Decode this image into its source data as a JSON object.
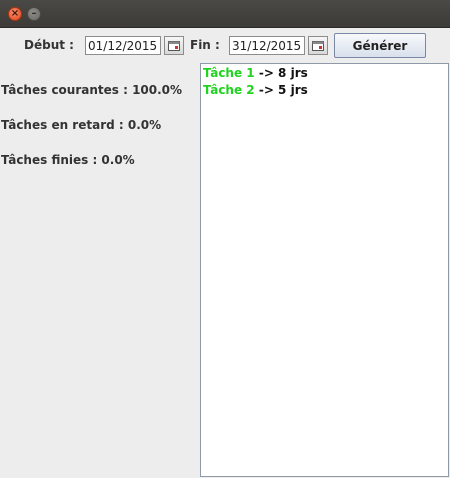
{
  "window": {
    "close_icon": "close-icon",
    "minimize_icon": "minimize-icon"
  },
  "form": {
    "debut_label": "Début :",
    "debut_value": "01/12/2015",
    "fin_label": "Fin :",
    "fin_value": "31/12/2015",
    "generate_label": "Générer",
    "calendar_icon": "calendar-icon"
  },
  "stats": [
    {
      "text": "Tâches courantes : 100.0%"
    },
    {
      "text": "Tâches en retard : 0.0%"
    },
    {
      "text": "Tâches finies : 0.0%"
    }
  ],
  "tasks": [
    {
      "name": "Tâche 1",
      "duration": "-> 8 jrs"
    },
    {
      "name": "Tâche 2",
      "duration": "-> 5 jrs"
    }
  ],
  "colors": {
    "task_name": "#1fd31f",
    "close_button": "#e2471d",
    "title_bar": "#3c3b37"
  }
}
